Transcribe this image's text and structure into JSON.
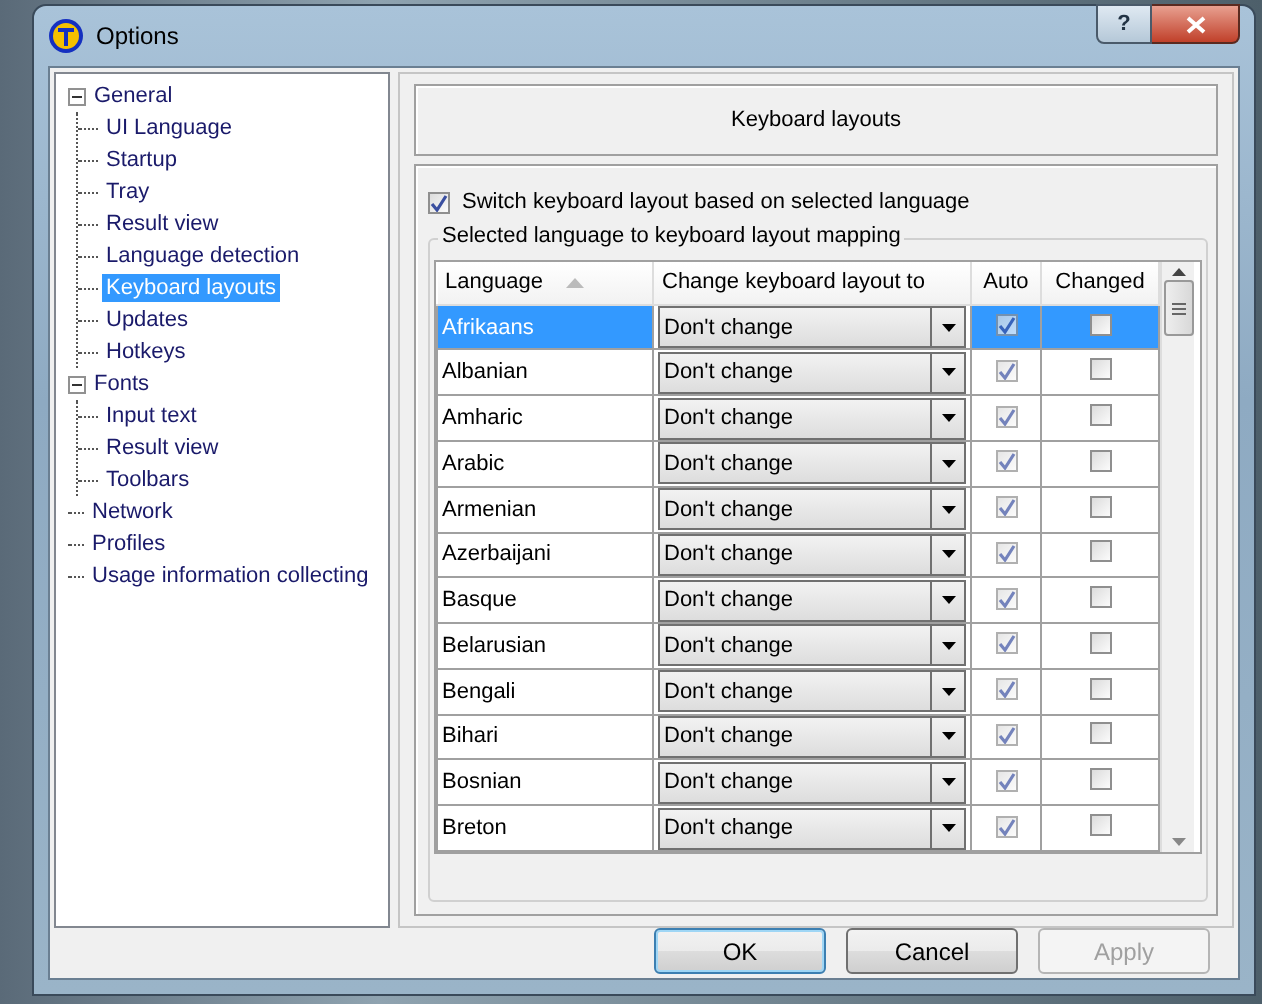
{
  "window": {
    "title": "Options",
    "help_button": "?"
  },
  "tree": [
    {
      "label": "General",
      "expanded": true,
      "selected": false,
      "children": [
        {
          "label": "UI Language",
          "selected": false
        },
        {
          "label": "Startup",
          "selected": false
        },
        {
          "label": "Tray",
          "selected": false
        },
        {
          "label": "Result view",
          "selected": false
        },
        {
          "label": "Language detection",
          "selected": false
        },
        {
          "label": "Keyboard layouts",
          "selected": true
        },
        {
          "label": "Updates",
          "selected": false
        },
        {
          "label": "Hotkeys",
          "selected": false
        }
      ]
    },
    {
      "label": "Fonts",
      "expanded": true,
      "selected": false,
      "children": [
        {
          "label": "Input text",
          "selected": false
        },
        {
          "label": "Result view",
          "selected": false
        },
        {
          "label": "Toolbars",
          "selected": false
        }
      ]
    },
    {
      "label": "Network",
      "selected": false
    },
    {
      "label": "Profiles",
      "selected": false
    },
    {
      "label": "Usage information collecting",
      "selected": false
    }
  ],
  "panel": {
    "title": "Keyboard layouts",
    "switch_option": {
      "label": "Switch keyboard layout based on selected language",
      "checked": true
    },
    "group_title": "Selected language to keyboard layout mapping",
    "table": {
      "columns": [
        "Language",
        "Change keyboard layout to",
        "Auto",
        "Changed"
      ],
      "rows": [
        {
          "language": "Afrikaans",
          "layout": "Don't change",
          "auto": true,
          "changed": false,
          "selected": true
        },
        {
          "language": "Albanian",
          "layout": "Don't change",
          "auto": true,
          "changed": false,
          "selected": false
        },
        {
          "language": "Amharic",
          "layout": "Don't change",
          "auto": true,
          "changed": false,
          "selected": false
        },
        {
          "language": "Arabic",
          "layout": "Don't change",
          "auto": true,
          "changed": false,
          "selected": false
        },
        {
          "language": "Armenian",
          "layout": "Don't change",
          "auto": true,
          "changed": false,
          "selected": false
        },
        {
          "language": "Azerbaijani",
          "layout": "Don't change",
          "auto": true,
          "changed": false,
          "selected": false
        },
        {
          "language": "Basque",
          "layout": "Don't change",
          "auto": true,
          "changed": false,
          "selected": false
        },
        {
          "language": "Belarusian",
          "layout": "Don't change",
          "auto": true,
          "changed": false,
          "selected": false
        },
        {
          "language": "Bengali",
          "layout": "Don't change",
          "auto": true,
          "changed": false,
          "selected": false
        },
        {
          "language": "Bihari",
          "layout": "Don't change",
          "auto": true,
          "changed": false,
          "selected": false
        },
        {
          "language": "Bosnian",
          "layout": "Don't change",
          "auto": true,
          "changed": false,
          "selected": false
        },
        {
          "language": "Breton",
          "layout": "Don't change",
          "auto": true,
          "changed": false,
          "selected": false
        }
      ]
    }
  },
  "buttons": [
    {
      "label": "OK",
      "default": true,
      "disabled": false
    },
    {
      "label": "Cancel",
      "default": false,
      "disabled": false
    },
    {
      "label": "Apply",
      "default": false,
      "disabled": true
    }
  ]
}
